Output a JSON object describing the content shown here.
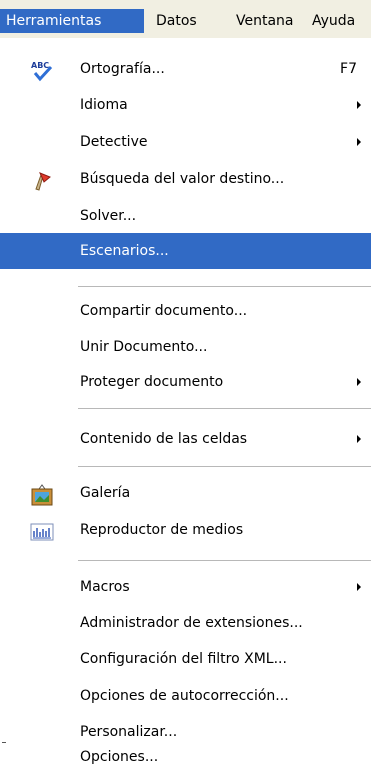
{
  "menubar": {
    "items": [
      {
        "label": "Herramientas"
      },
      {
        "label": "Datos"
      },
      {
        "label": "Ventana"
      },
      {
        "label": "Ayuda"
      }
    ]
  },
  "menu": {
    "selected_color": "#316ac5",
    "items": [
      {
        "label": "Ortografía...",
        "shortcut": "F7",
        "icon": "spellcheck-icon"
      },
      {
        "label": "Idioma",
        "submenu": true
      },
      {
        "label": "Detective",
        "submenu": true
      },
      {
        "label": "Búsqueda del valor destino...",
        "icon": "goal-seek-icon"
      },
      {
        "label": "Solver..."
      },
      {
        "label": "Escenarios...",
        "selected": true
      },
      {
        "label": "Compartir documento..."
      },
      {
        "label": "Unir Documento..."
      },
      {
        "label": "Proteger documento",
        "submenu": true
      },
      {
        "label": "Contenido de las celdas",
        "submenu": true
      },
      {
        "label": "Galería",
        "icon": "gallery-icon"
      },
      {
        "label": "Reproductor de medios",
        "icon": "media-player-icon"
      },
      {
        "label": "Macros",
        "submenu": true
      },
      {
        "label": "Administrador de extensiones..."
      },
      {
        "label": "Configuración del filtro XML..."
      },
      {
        "label": "Opciones de autocorrección..."
      },
      {
        "label": "Personalizar..."
      },
      {
        "label": "Opciones..."
      }
    ]
  }
}
